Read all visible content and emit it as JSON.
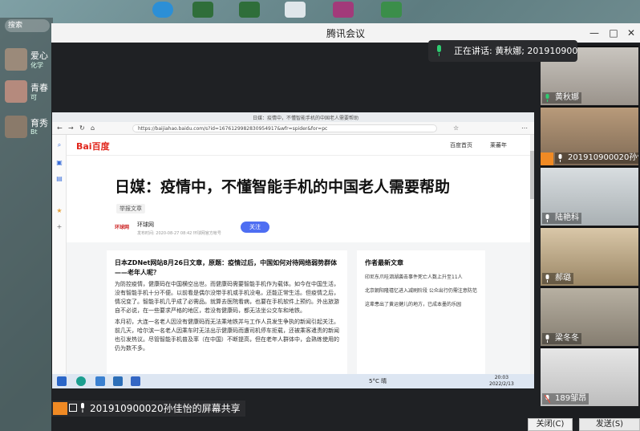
{
  "desktop": {
    "chat_search": "搜索",
    "chats": [
      {
        "name": "爱心",
        "sub": "化学"
      },
      {
        "name": "青春",
        "sub": "可"
      },
      {
        "name": "育秀",
        "sub": "Bt"
      }
    ]
  },
  "window": {
    "title": "腾讯会议",
    "minimize": "—",
    "maximize": "□",
    "close": "✕"
  },
  "speaking": {
    "text": "正在讲话: 黄秋娜; 201910900..."
  },
  "participants": [
    {
      "name": "黄秋娜",
      "mic": "on",
      "host": false
    },
    {
      "name": "201910900020孙佳...",
      "mic": "on",
      "host": true
    },
    {
      "name": "陆艳科",
      "mic": "on",
      "host": false
    },
    {
      "name": "郝璐",
      "mic": "on",
      "host": false
    },
    {
      "name": "梁冬冬",
      "mic": "on",
      "host": false
    },
    {
      "name": "189邹昂",
      "mic": "muted",
      "host": false
    }
  ],
  "share_label": "201910900020孙佳怡的屏幕共享",
  "buttons": {
    "close": "关闭(C)",
    "send": "发送(S)"
  },
  "browser": {
    "tab_title": "日媒：疫情中，不懂智能手机的中国老人需要帮助",
    "url": "https://baijiahao.baidu.com/s?id=1676129982830954917&wfr=spider&for=pc",
    "header_links": [
      "百度首页",
      "莱蕃年"
    ],
    "logo": "Bai百度",
    "article": {
      "title": "日媒：疫情中，不懂智能手机的中国老人需要帮助",
      "tag": "举报文章",
      "source_name": "环球网",
      "source_meta": "发布时间: 2020-08-27 08:42   环球网官方帐号",
      "follow": "关注",
      "lead": "日本ZDNet网站8月26日文章，原题：疫情过后，中国如何对待网络弱势群体——老年人呢？",
      "para1": "为防控疫情，健康码在中国横空出世。而健康码需要智能手机作为载体。如今在中国生活，没有智能手机十分不便。以前看是偶尔没带手机或手机没电，还能正常生活。但疫情之后，情况变了。智能手机几乎成了必需品。就算去医院看病，也要在手机软件上预约。外出旅游自不必说，在一些要求严格的地区，若没有健康码，都无法坐公交车和地铁。",
      "para2": "本月初，大连一名老人因没有健康码而无法乘地铁并与工作人员发生争执的新闻引起关注。前几天，哈尔滨一名老人因乘车时无法出示健康码而遭司机停车拒载，还被乘客遣责的新闻也引发热议。尽管智能手机普及率（在中国）不断提高，但在老年人群体中，会熟练使用的仍为数不多。"
    },
    "sidebar_title": "作者最新文章",
    "sidebar_items": [
      "印尼东爪哇泗湖袭击事件死亡人数上升至11人",
      "北京朝阳隆禧忆进入减刷阶段 公众出行仍需注意防范",
      "这辈患出了黄运健儿的地方，已成本墨的乐园"
    ],
    "taskbar": {
      "weather": "5°C 晴",
      "time": "20:03",
      "date": "2022/2/13"
    }
  },
  "colors": {
    "accent": "#4e6ef2",
    "host": "#f08a24",
    "mic_on": "#2ecc71"
  }
}
